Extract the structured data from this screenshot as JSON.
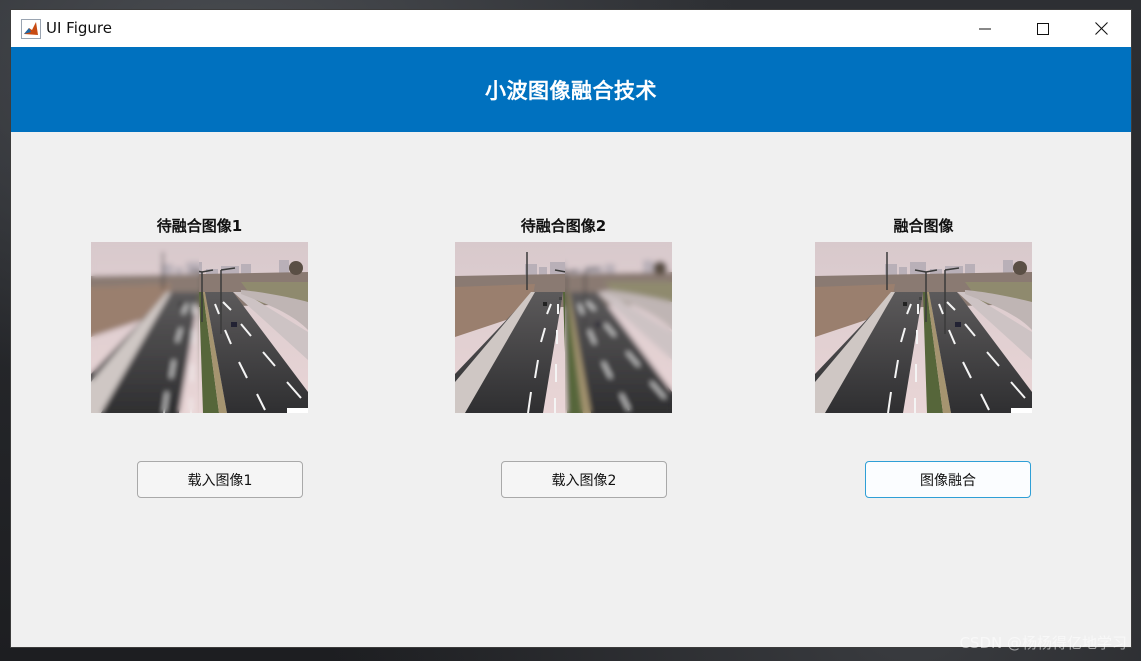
{
  "window": {
    "title": "UI Figure",
    "icon": "matlab-icon",
    "controls": [
      "minimize-icon",
      "maximize-icon",
      "close-icon"
    ]
  },
  "header": {
    "title": "小波图像融合技术",
    "background": "#0071bf"
  },
  "panels": [
    {
      "label": "待融合图像1",
      "image": "highway-photo-blurred-left"
    },
    {
      "label": "待融合图像2",
      "image": "highway-photo-blurred-right"
    },
    {
      "label": "融合图像",
      "image": "highway-photo-fused"
    }
  ],
  "buttons": {
    "load1": "载入图像1",
    "load2": "载入图像2",
    "fuse": "图像融合"
  },
  "watermark": "CSDN @杨杨得亿地学习"
}
